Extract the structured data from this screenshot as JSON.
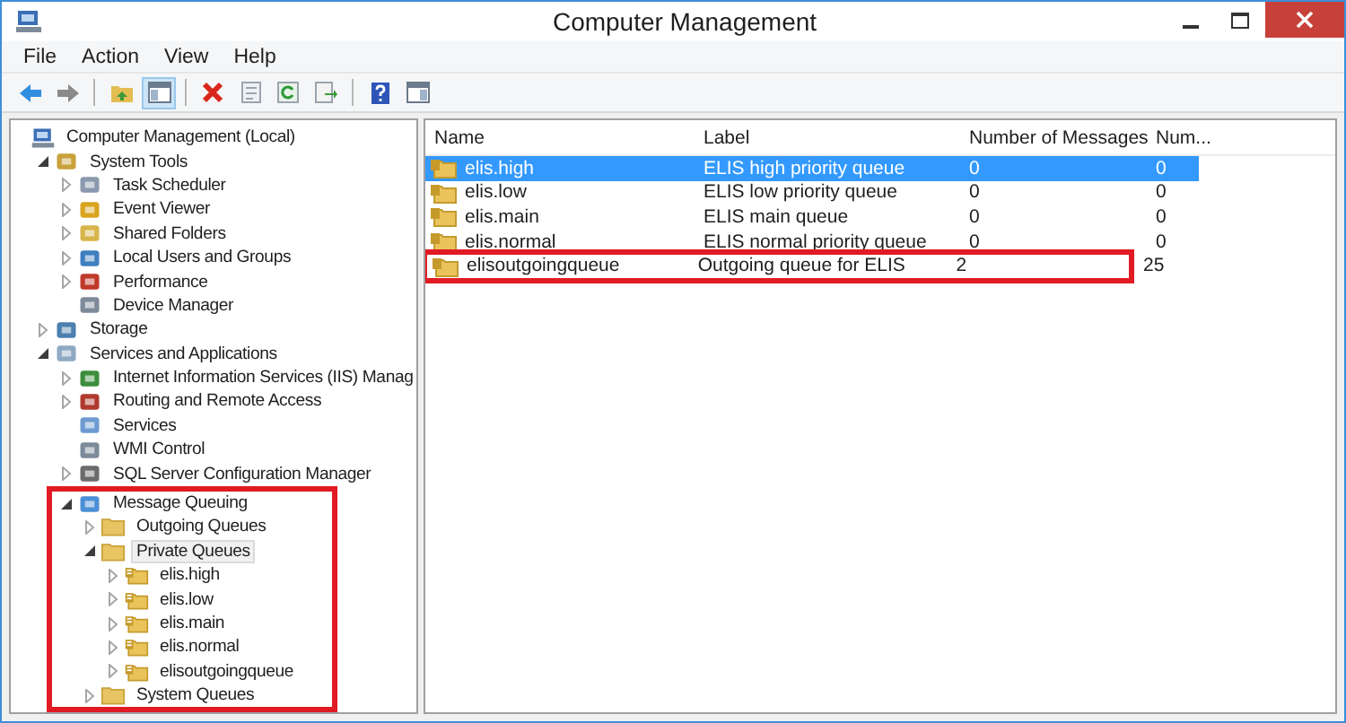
{
  "window": {
    "title": "Computer Management"
  },
  "menu": [
    "File",
    "Action",
    "View",
    "Help"
  ],
  "toolbar": [
    {
      "kind": "back",
      "pressed": false
    },
    {
      "kind": "forward",
      "pressed": false
    },
    {
      "kind": "sep"
    },
    {
      "kind": "up",
      "pressed": false
    },
    {
      "kind": "pane",
      "pressed": true
    },
    {
      "kind": "sep"
    },
    {
      "kind": "delete",
      "pressed": false
    },
    {
      "kind": "properties",
      "pressed": false
    },
    {
      "kind": "refresh",
      "pressed": false
    },
    {
      "kind": "export",
      "pressed": false
    },
    {
      "kind": "sep"
    },
    {
      "kind": "help",
      "pressed": false
    },
    {
      "kind": "view",
      "pressed": false
    }
  ],
  "tree": [
    {
      "label": "Computer Management (Local)",
      "kind": "computer",
      "selected": false,
      "children": [
        {
          "label": "System Tools",
          "kind": "tools",
          "expanded": true,
          "selected": false,
          "children": [
            {
              "label": "Task Scheduler",
              "kind": "clock",
              "expanded": false,
              "selected": false
            },
            {
              "label": "Event Viewer",
              "kind": "log",
              "expanded": false,
              "selected": false
            },
            {
              "label": "Shared Folders",
              "kind": "share",
              "expanded": false,
              "selected": false
            },
            {
              "label": "Local Users and Groups",
              "kind": "users",
              "expanded": false,
              "selected": false
            },
            {
              "label": "Performance",
              "kind": "perf",
              "expanded": false,
              "selected": false
            },
            {
              "label": "Device Manager",
              "kind": "device",
              "selected": false
            }
          ]
        },
        {
          "label": "Storage",
          "kind": "storage",
          "expanded": false,
          "selected": false
        },
        {
          "label": "Services and Applications",
          "kind": "services",
          "expanded": true,
          "selected": false,
          "children": [
            {
              "label": "Internet Information Services (IIS) Manag",
              "kind": "web",
              "expanded": false,
              "selected": false
            },
            {
              "label": "Routing and Remote Access",
              "kind": "routing",
              "expanded": false,
              "selected": false
            },
            {
              "label": "Services",
              "kind": "gear",
              "selected": false
            },
            {
              "label": "WMI Control",
              "kind": "device",
              "selected": false
            },
            {
              "label": "SQL Server Configuration Manager",
              "kind": "sql",
              "expanded": false,
              "selected": false
            },
            {
              "label": "Message Queuing",
              "kind": "mq",
              "expanded": true,
              "selected": false,
              "highlighted": true,
              "children": [
                {
                  "label": "Outgoing Queues",
                  "kind": "folder",
                  "expanded": false,
                  "selected": false
                },
                {
                  "label": "Private Queues",
                  "kind": "folder",
                  "expanded": true,
                  "selected": true,
                  "children": [
                    {
                      "label": "elis.high",
                      "kind": "queue",
                      "expanded": false,
                      "selected": false
                    },
                    {
                      "label": "elis.low",
                      "kind": "queue",
                      "expanded": false,
                      "selected": false
                    },
                    {
                      "label": "elis.main",
                      "kind": "queue",
                      "expanded": false,
                      "selected": false
                    },
                    {
                      "label": "elis.normal",
                      "kind": "queue",
                      "expanded": false,
                      "selected": false
                    },
                    {
                      "label": "elisoutgoingqueue",
                      "kind": "queue",
                      "expanded": false,
                      "selected": false
                    }
                  ]
                },
                {
                  "label": "System Queues",
                  "kind": "folder",
                  "expanded": false,
                  "selected": false
                }
              ]
            }
          ]
        }
      ]
    }
  ],
  "table": {
    "columns": [
      "Name",
      "Label",
      "Number of Messages",
      "Num..."
    ],
    "rows": [
      {
        "name": "elis.high",
        "label": "ELIS high priority queue",
        "messages": "0",
        "column_4": "0",
        "selected": true,
        "highlighted": false
      },
      {
        "name": "elis.low",
        "label": "ELIS low priority queue",
        "messages": "0",
        "column_4": "0",
        "selected": false,
        "highlighted": false
      },
      {
        "name": "elis.main",
        "label": "ELIS main queue",
        "messages": "0",
        "column_4": "0",
        "selected": false,
        "highlighted": false
      },
      {
        "name": "elis.normal",
        "label": "ELIS normal priority queue",
        "messages": "0",
        "column_4": "0",
        "selected": false,
        "highlighted": false
      },
      {
        "name": "elisoutgoingqueue",
        "label": "Outgoing queue for ELIS",
        "messages": "2",
        "column_4": "25",
        "selected": false,
        "highlighted": true
      }
    ]
  }
}
